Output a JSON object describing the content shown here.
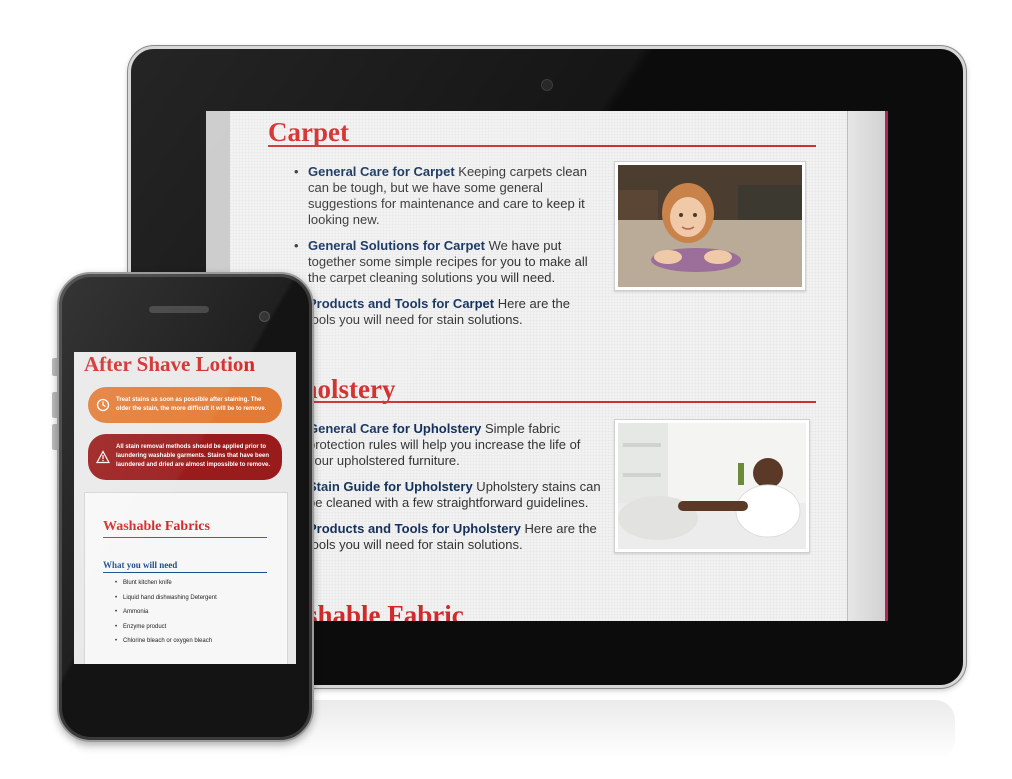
{
  "tablet": {
    "sections": [
      {
        "title": "Carpet",
        "items": [
          {
            "link": "General Care for Carpet",
            "text": " Keeping carpets clean can be tough, but we have some general suggestions for maintenance and care to keep it looking new."
          },
          {
            "link": "General Solutions for Carpet",
            "text": " We have put together some simple recipes for you to make all the carpet cleaning solutions you will need."
          },
          {
            "link": "Products and Tools for Carpet",
            "text": " Here are the tools you will need for stain solutions."
          }
        ]
      },
      {
        "title": "Upholstery",
        "items": [
          {
            "link": "General Care for Upholstery",
            "text": " Simple fabric protection rules will help you increase the life of your upholstered furniture."
          },
          {
            "link": "Stain Guide for Upholstery",
            "text": " Upholstery stains can be cleaned with a few straightforward guidelines."
          },
          {
            "link": "Products and Tools for Upholstery",
            "text": " Here are the tools you will need for stain solutions."
          }
        ]
      },
      {
        "title": "Washable Fabric"
      }
    ]
  },
  "phone": {
    "title": "After Shave Lotion",
    "tip_orange": "Treat stains as soon as possible after staining. The older the stain, the more difficult it will be to remove.",
    "tip_red": "All stain removal methods should be applied prior to laundering washable garments. Stains that have been laundered and dried are almost impossible to remove.",
    "card": {
      "title": "Washable Fabrics",
      "subtitle": "What you will need",
      "items": [
        "Blunt kitchen knife",
        "Liquid hand dishwashing Detergent",
        "Ammonia",
        "Enzyme product",
        "Chlorine bleach or oxygen bleach"
      ]
    },
    "colors": {
      "orange": "#e27b35",
      "red": "#9a1b1b"
    }
  }
}
